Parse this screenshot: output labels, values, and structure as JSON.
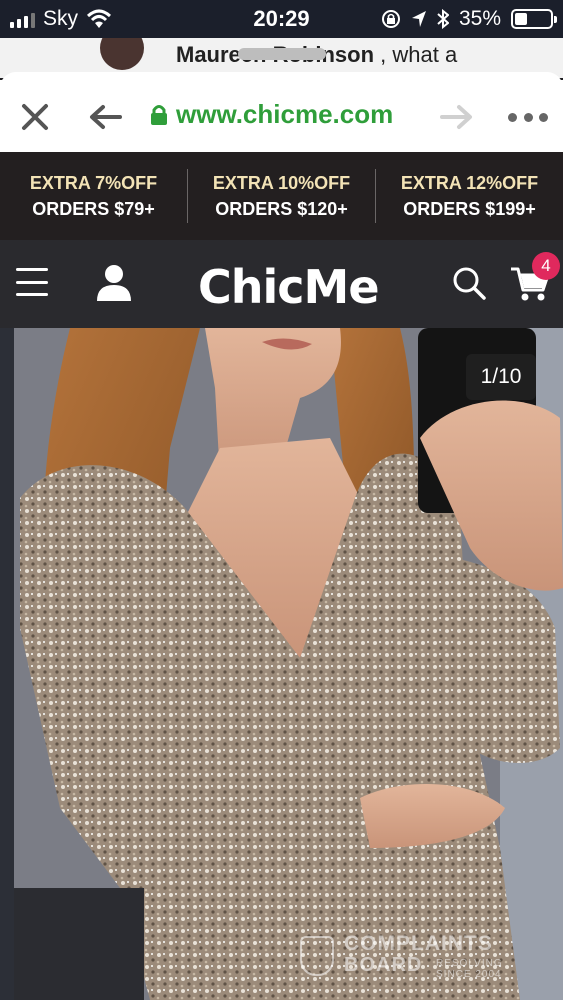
{
  "status_bar": {
    "carrier": "Sky",
    "time": "20:29",
    "battery": "35%",
    "battery_level": 0.35
  },
  "background_app": {
    "name": "Maureen Robinson",
    "message": ", what a"
  },
  "browser": {
    "url": "www.chicme.com",
    "url_color": "#2f9e3a"
  },
  "promos": [
    {
      "top": "EXTRA 7%OFF",
      "bottom": "ORDERS $79+"
    },
    {
      "top": "EXTRA 10%OFF",
      "bottom": "ORDERS $120+"
    },
    {
      "top": "EXTRA 12%OFF",
      "bottom": "ORDERS $199+"
    }
  ],
  "site_header": {
    "logo": "ChicMe",
    "cart_count": "4",
    "accent": "#e0295d"
  },
  "product": {
    "image_counter": "1/10"
  },
  "watermark": {
    "line1": "COMPLAINTS",
    "line2": "BOARD",
    "line3": "RESOLVING",
    "line4": "SINCE 2004"
  },
  "icons": [
    "wifi-icon",
    "lock-icon",
    "location-icon",
    "bluetooth-icon",
    "close-icon",
    "back-arrow-icon",
    "padlock-icon",
    "forward-arrow-icon",
    "more-icon",
    "menu-icon",
    "user-icon",
    "search-icon",
    "cart-icon"
  ]
}
